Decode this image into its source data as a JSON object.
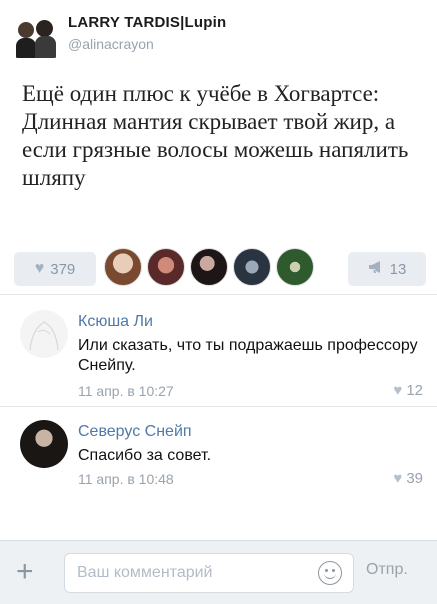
{
  "post": {
    "author_name": "LARRY TARDIS|Lupin",
    "author_handle": "@alinacrayon",
    "text": "Ещё один плюс к учёбе в Хогвартсе: Длинная мантия скрывает твой жир, а если грязные волосы можешь напялить шляпу"
  },
  "reactions": {
    "likes": "379",
    "shares": "13",
    "likers": [
      "#d9b9a0",
      "#6b3a3a",
      "#2a2020",
      "#3b4a5a",
      "#3e6b3a"
    ],
    "heart_icon": "heart-icon",
    "share_icon": "megaphone-icon"
  },
  "comments": [
    {
      "name": "Ксюша Ли",
      "text": "Или сказать, что ты подражаешь профессору Снейпу.",
      "date": "11 апр. в 10:27",
      "likes": "12"
    },
    {
      "name": "Северус Снейп",
      "text": "Спасибо за совет.",
      "date": "11 апр. в 10:48",
      "likes": "39"
    }
  ],
  "composer": {
    "placeholder": "Ваш комментарий",
    "send_label": "Отпр.",
    "plus_icon": "plus-icon",
    "emoji_icon": "smile-icon"
  },
  "colors": {
    "link": "#4f7aa8",
    "muted": "#9aa3ad",
    "pill": "#e9edf1"
  }
}
